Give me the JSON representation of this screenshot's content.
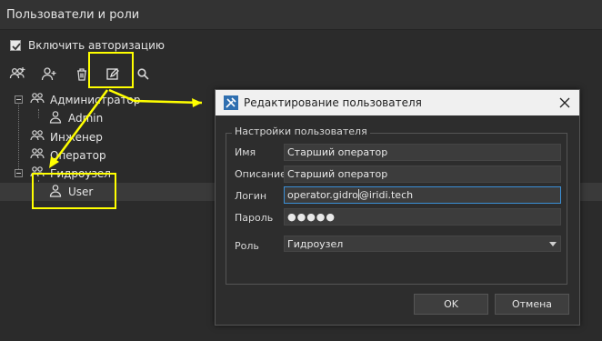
{
  "window": {
    "title": "Пользователи и роли"
  },
  "auth": {
    "label": "Включить авторизацию",
    "checked": true
  },
  "toolbar": {
    "icons": [
      "add-group-icon",
      "add-user-icon",
      "delete-icon",
      "edit-icon",
      "search-icon"
    ]
  },
  "tree": {
    "items": [
      {
        "label": "Администратор",
        "type": "group",
        "expanded": true
      },
      {
        "label": "Admin",
        "type": "user"
      },
      {
        "label": "Инженер",
        "type": "group"
      },
      {
        "label": "Оператор",
        "type": "group"
      },
      {
        "label": "Гидроузел",
        "type": "group",
        "expanded": true
      },
      {
        "label": "User",
        "type": "user",
        "selected": true
      }
    ]
  },
  "dialog": {
    "title": "Редактирование пользователя",
    "group_title": "Настройки пользователя",
    "fields": {
      "name": {
        "label": "Имя",
        "value": "Старший оператор"
      },
      "description": {
        "label": "Описание",
        "value": "Старший оператор"
      },
      "login": {
        "label": "Логин",
        "value_before_caret": "operator.gidro",
        "value_after_caret": "@iridi.tech"
      },
      "password": {
        "label": "Пароль",
        "value": "●●●●●"
      },
      "role": {
        "label": "Роль",
        "value": "Гидроузел"
      }
    },
    "ok_label": "OK",
    "cancel_label": "Отмена"
  },
  "colors": {
    "highlight": "#ffff00",
    "accent": "#3b8fd6",
    "dialog_icon": "#2f6fb0"
  }
}
